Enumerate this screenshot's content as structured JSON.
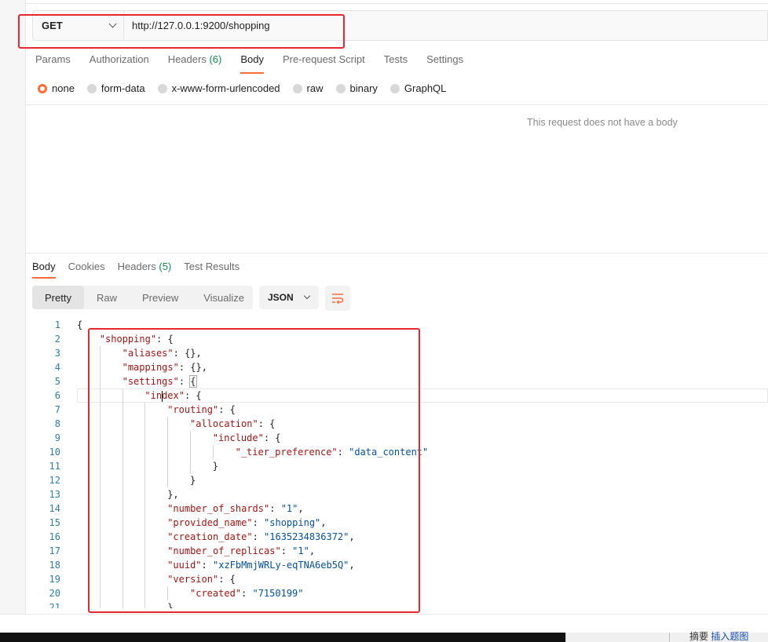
{
  "request": {
    "method": "GET",
    "url": "http://127.0.0.1:9200/shopping",
    "tabs": [
      {
        "label": "Params"
      },
      {
        "label": "Authorization"
      },
      {
        "label": "Headers",
        "count": "(6)"
      },
      {
        "label": "Body"
      },
      {
        "label": "Pre-request Script"
      },
      {
        "label": "Tests"
      },
      {
        "label": "Settings"
      }
    ],
    "active_tab": "Body",
    "body_types": [
      "none",
      "form-data",
      "x-www-form-urlencoded",
      "raw",
      "binary",
      "GraphQL"
    ],
    "selected_body_type": "none",
    "empty_body_message": "This request does not have a body"
  },
  "response": {
    "tabs": [
      {
        "label": "Body"
      },
      {
        "label": "Cookies"
      },
      {
        "label": "Headers",
        "count": "(5)"
      },
      {
        "label": "Test Results"
      }
    ],
    "active_tab": "Body",
    "view_modes": [
      "Pretty",
      "Raw",
      "Preview",
      "Visualize"
    ],
    "active_view": "Pretty",
    "format": "JSON",
    "lines": [
      {
        "n": "1",
        "indent": 0,
        "tokens": [
          [
            "p",
            "{"
          ]
        ]
      },
      {
        "n": "2",
        "indent": 1,
        "tokens": [
          [
            "k",
            "\"shopping\""
          ],
          [
            "p",
            ": {"
          ]
        ]
      },
      {
        "n": "3",
        "indent": 2,
        "tokens": [
          [
            "k",
            "\"aliases\""
          ],
          [
            "p",
            ": {},"
          ]
        ]
      },
      {
        "n": "4",
        "indent": 2,
        "tokens": [
          [
            "k",
            "\"mappings\""
          ],
          [
            "p",
            ": {},"
          ]
        ]
      },
      {
        "n": "5",
        "indent": 2,
        "tokens": [
          [
            "k",
            "\"settings\""
          ],
          [
            "p",
            ": "
          ],
          [
            "b",
            "{"
          ]
        ]
      },
      {
        "n": "6",
        "indent": 3,
        "tokens": [
          [
            "k",
            "\"in"
          ],
          [
            "c",
            ""
          ],
          [
            "k",
            "dex\""
          ],
          [
            "p",
            ": {"
          ]
        ]
      },
      {
        "n": "7",
        "indent": 4,
        "tokens": [
          [
            "k",
            "\"routing\""
          ],
          [
            "p",
            ": {"
          ]
        ]
      },
      {
        "n": "8",
        "indent": 5,
        "tokens": [
          [
            "k",
            "\"allocation\""
          ],
          [
            "p",
            ": {"
          ]
        ]
      },
      {
        "n": "9",
        "indent": 6,
        "tokens": [
          [
            "k",
            "\"include\""
          ],
          [
            "p",
            ": {"
          ]
        ]
      },
      {
        "n": "10",
        "indent": 7,
        "tokens": [
          [
            "k",
            "\"_tier_preference\""
          ],
          [
            "p",
            ": "
          ],
          [
            "s",
            "\"data_content\""
          ]
        ]
      },
      {
        "n": "11",
        "indent": 6,
        "tokens": [
          [
            "p",
            "}"
          ]
        ]
      },
      {
        "n": "12",
        "indent": 5,
        "tokens": [
          [
            "p",
            "}"
          ]
        ]
      },
      {
        "n": "13",
        "indent": 4,
        "tokens": [
          [
            "p",
            "},"
          ]
        ]
      },
      {
        "n": "14",
        "indent": 4,
        "tokens": [
          [
            "k",
            "\"number_of_shards\""
          ],
          [
            "p",
            ": "
          ],
          [
            "s",
            "\"1\""
          ],
          [
            "p",
            ","
          ]
        ]
      },
      {
        "n": "15",
        "indent": 4,
        "tokens": [
          [
            "k",
            "\"provided_name\""
          ],
          [
            "p",
            ": "
          ],
          [
            "s",
            "\"shopping\""
          ],
          [
            "p",
            ","
          ]
        ]
      },
      {
        "n": "16",
        "indent": 4,
        "tokens": [
          [
            "k",
            "\"creation_date\""
          ],
          [
            "p",
            ": "
          ],
          [
            "s",
            "\"1635234836372\""
          ],
          [
            "p",
            ","
          ]
        ]
      },
      {
        "n": "17",
        "indent": 4,
        "tokens": [
          [
            "k",
            "\"number_of_replicas\""
          ],
          [
            "p",
            ": "
          ],
          [
            "s",
            "\"1\""
          ],
          [
            "p",
            ","
          ]
        ]
      },
      {
        "n": "18",
        "indent": 4,
        "tokens": [
          [
            "k",
            "\"uuid\""
          ],
          [
            "p",
            ": "
          ],
          [
            "s",
            "\"xzFbMmjWRLy-eqTNA6eb5Q\""
          ],
          [
            "p",
            ","
          ]
        ]
      },
      {
        "n": "19",
        "indent": 4,
        "tokens": [
          [
            "k",
            "\"version\""
          ],
          [
            "p",
            ": {"
          ]
        ]
      },
      {
        "n": "20",
        "indent": 5,
        "tokens": [
          [
            "k",
            "\"created\""
          ],
          [
            "p",
            ": "
          ],
          [
            "s",
            "\"7150199\""
          ]
        ]
      },
      {
        "n": "21",
        "indent": 4,
        "tokens": [
          [
            "p",
            "}"
          ]
        ]
      }
    ]
  },
  "taskbar": {
    "left_text": "摘要",
    "link_text": "插入题图"
  },
  "colors": {
    "accent": "#ff6c37",
    "annotation": "#e8272f",
    "json_key": "#a31515",
    "json_string": "#0451a5",
    "line_number": "#2e7ea6"
  }
}
